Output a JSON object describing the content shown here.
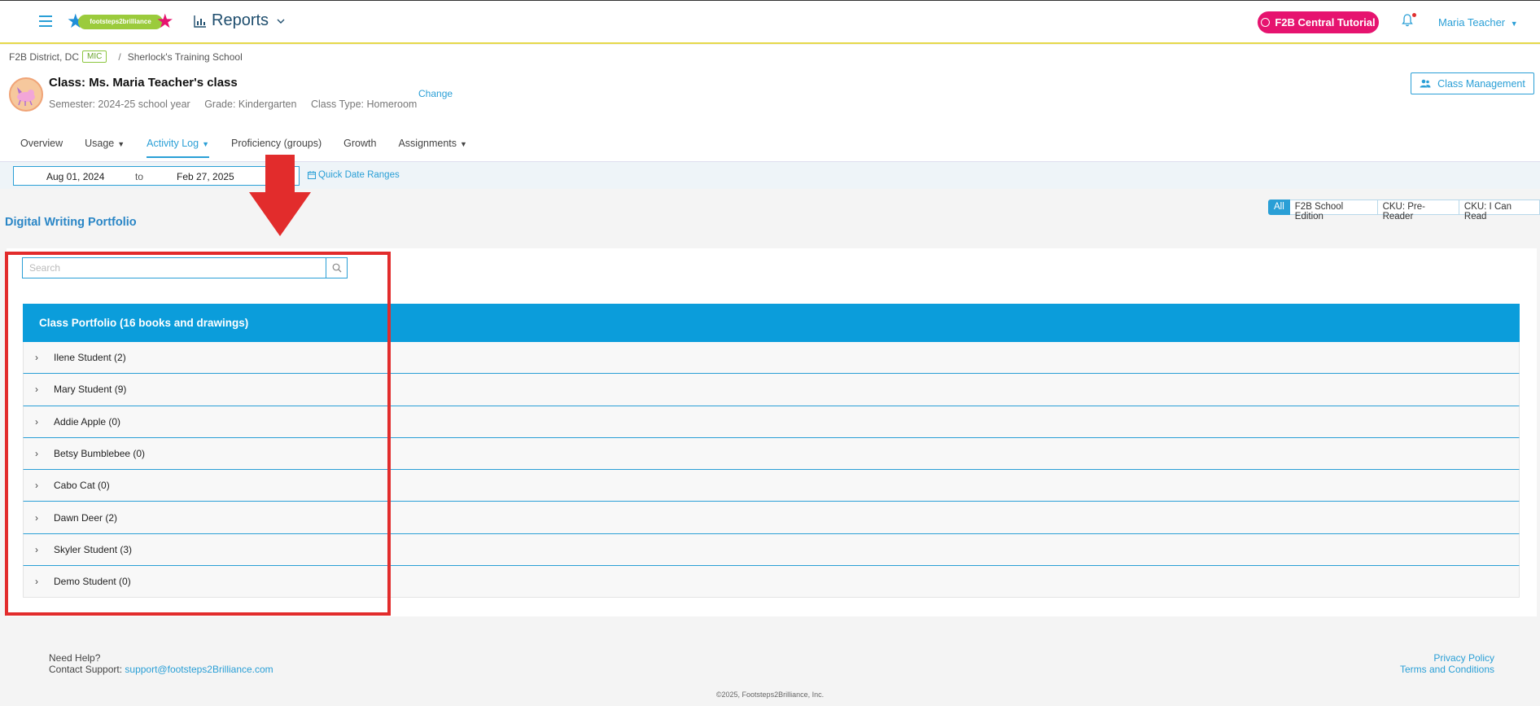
{
  "header": {
    "logo_text": "footsteps2brilliance",
    "reports_label": "Reports",
    "tutorial_label": "F2B Central Tutorial",
    "user_label": "Maria Teacher"
  },
  "breadcrumb": {
    "district": "F2B District, DC",
    "badge": "MIC",
    "separator": "/",
    "school": "Sherlock's Training School"
  },
  "class_info": {
    "title": "Class: Ms. Maria Teacher's class",
    "semester": "Semester: 2024-25 school year",
    "grade": "Grade: Kindergarten",
    "class_type": "Class Type: Homeroom",
    "change_label": "Change",
    "management_label": "Class Management"
  },
  "tabs": [
    {
      "label": "Overview",
      "dropdown": false
    },
    {
      "label": "Usage",
      "dropdown": true
    },
    {
      "label": "Activity Log",
      "dropdown": true,
      "active": true
    },
    {
      "label": "Proficiency (groups)",
      "dropdown": false
    },
    {
      "label": "Growth",
      "dropdown": false
    },
    {
      "label": "Assignments",
      "dropdown": true
    }
  ],
  "date_range": {
    "from": "Aug 01, 2024",
    "to_label": "to",
    "end": "Feb 27, 2025",
    "quick_label": "Quick Date Ranges"
  },
  "page_title": "Digital Writing Portfolio",
  "filters": [
    "All",
    "F2B School Edition",
    "CKU: Pre-Reader",
    "CKU: I Can Read"
  ],
  "search": {
    "placeholder": "Search"
  },
  "portfolio": {
    "header": "Class Portfolio (16 books and drawings)",
    "students": [
      "Ilene Student (2)",
      "Mary Student (9)",
      "Addie Apple (0)",
      "Betsy Bumblebee (0)",
      "Cabo Cat (0)",
      "Dawn Deer (2)",
      "Skyler Student (3)",
      "Demo Student (0)"
    ]
  },
  "footer": {
    "need_help": "Need Help?",
    "contact_label": "Contact Support:",
    "support_email": "support@footsteps2Brilliance.com",
    "privacy": "Privacy Policy",
    "terms": "Terms and Conditions",
    "copyright": "©2025, Footsteps2Brilliance, Inc."
  },
  "colors": {
    "accent": "#2a9fd6",
    "portfolio_header": "#0b9ddb",
    "tutorial": "#e6136f",
    "annotation": "#e22c2c"
  }
}
